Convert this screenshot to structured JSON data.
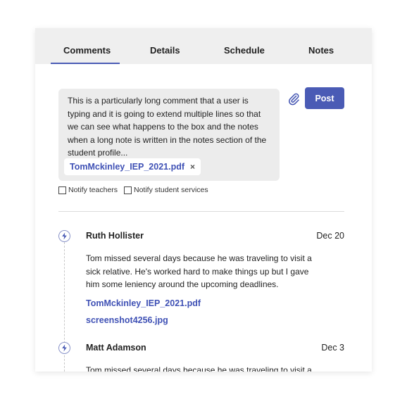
{
  "tabs": [
    {
      "label": "Comments",
      "active": true
    },
    {
      "label": "Details",
      "active": false
    },
    {
      "label": "Schedule",
      "active": false
    },
    {
      "label": "Notes",
      "active": false
    }
  ],
  "composer": {
    "text": "This is a particularly long comment that a user is typing and it is going to extend multiple lines so that we can see what happens to the box and the notes when a long note is written in the notes section of the student profile...",
    "attachment": "TomMckinley_IEP_2021.pdf",
    "remove_label": "×",
    "post_label": "Post",
    "notify_teachers_label": "Notify teachers",
    "notify_student_services_label": "Notify student services",
    "notify_teachers_checked": false,
    "notify_student_services_checked": false
  },
  "comments": [
    {
      "author": "Ruth Hollister",
      "date": "Dec 20",
      "text": "Tom missed several days because he was traveling to visit a sick relative. He's worked hard to make things up but I gave him some leniency around the upcoming deadlines.",
      "attachments": [
        "TomMckinley_IEP_2021.pdf",
        "screenshot4256.jpg"
      ]
    },
    {
      "author": "Matt Adamson",
      "date": "Dec 3",
      "text": "Tom missed several days because he was traveling to visit a"
    }
  ],
  "colors": {
    "accent": "#4a5bb5",
    "link": "#3f51b5",
    "tabbar_bg": "#efefef",
    "composer_bg": "#ececec"
  },
  "icons": {
    "attach": "paperclip-icon",
    "timeline_node": "lightning-icon"
  }
}
